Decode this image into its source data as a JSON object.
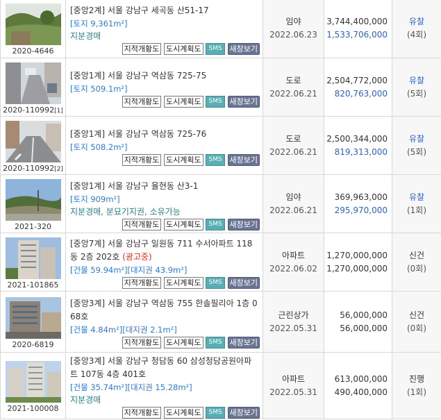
{
  "buttons": {
    "cadastral": "지적개황도",
    "city_plan": "도시계획도",
    "sms": "SMS",
    "new_window": "새창보기"
  },
  "listings": [
    {
      "case_no": "2020-4646",
      "case_sub": "",
      "court": "[중앙2계]",
      "address_line1": "서울 강남구 세곡동 산51-17",
      "address_line2": "",
      "area": "[토지 9,361m²]",
      "note": "지분경매",
      "ad": "",
      "use": "임야",
      "date": "2022.06.23",
      "appraisal": "3,744,400,000",
      "minimum": "1,533,706,000",
      "status": "유찰",
      "count": "(4회)"
    },
    {
      "case_no": "2020-110992",
      "case_sub": "[1]",
      "court": "[중앙1계]",
      "address_line1": "서울 강남구 역삼동 725-75",
      "address_line2": "",
      "area": "[토지 509.1m²]",
      "note": "",
      "ad": "",
      "use": "도로",
      "date": "2022.06.21",
      "appraisal": "2,504,772,000",
      "minimum": "820,763,000",
      "status": "유찰",
      "count": "(5회)"
    },
    {
      "case_no": "2020-110992",
      "case_sub": "[2]",
      "court": "[중앙1계]",
      "address_line1": "서울 강남구 역삼동 725-76",
      "address_line2": "",
      "area": "[토지 508.2m²]",
      "note": "",
      "ad": "",
      "use": "도로",
      "date": "2022.06.21",
      "appraisal": "2,500,344,000",
      "minimum": "819,313,000",
      "status": "유찰",
      "count": "(5회)"
    },
    {
      "case_no": "2021-320",
      "case_sub": "",
      "court": "[중앙1계]",
      "address_line1": "서울 강남구 율현동 산3-1",
      "address_line2": "",
      "area": "[토지 909m²]",
      "note": "지분경매, 분묘기지권, 소유가능",
      "ad": "",
      "use": "임야",
      "date": "2022.06.21",
      "appraisal": "369,963,000",
      "minimum": "295,970,000",
      "status": "유찰",
      "count": "(1회)"
    },
    {
      "case_no": "2021-101865",
      "case_sub": "",
      "court": "[중앙7계]",
      "address_line1": "서울 강남구 일원동 711 수서아파트 118",
      "address_line2": "동 2층 202호",
      "area": "[건물 59.94m²][대지권 43.9m²]",
      "note": "",
      "ad": "(광고중)",
      "use": "아파트",
      "date": "2022.06.02",
      "appraisal": "1,270,000,000",
      "minimum": "1,270,000,000",
      "status": "신건",
      "count": "(0회)"
    },
    {
      "case_no": "2020-6819",
      "case_sub": "",
      "court": "[중앙3계]",
      "address_line1": "서울 강남구 역삼동 755 한솔필리아 1층 0",
      "address_line2": "68호",
      "area": "[건물 4.84m²][대지권 2.1m²]",
      "note": "",
      "ad": "",
      "use": "근린상가",
      "date": "2022.05.31",
      "appraisal": "56,000,000",
      "minimum": "56,000,000",
      "status": "신건",
      "count": "(0회)"
    },
    {
      "case_no": "2021-100008",
      "case_sub": "",
      "court": "[중앙3계]",
      "address_line1": "서울 강남구 청담동 60 삼성청담공원아파",
      "address_line2": "트 107동 4층 401호",
      "area": "[건물 35.74m²][대지권 15.28m²]",
      "note": "지분경매",
      "ad": "",
      "use": "아파트",
      "date": "2022.05.31",
      "appraisal": "613,000,000",
      "minimum": "490,400,000",
      "status": "진행",
      "count": "(1회)"
    }
  ]
}
